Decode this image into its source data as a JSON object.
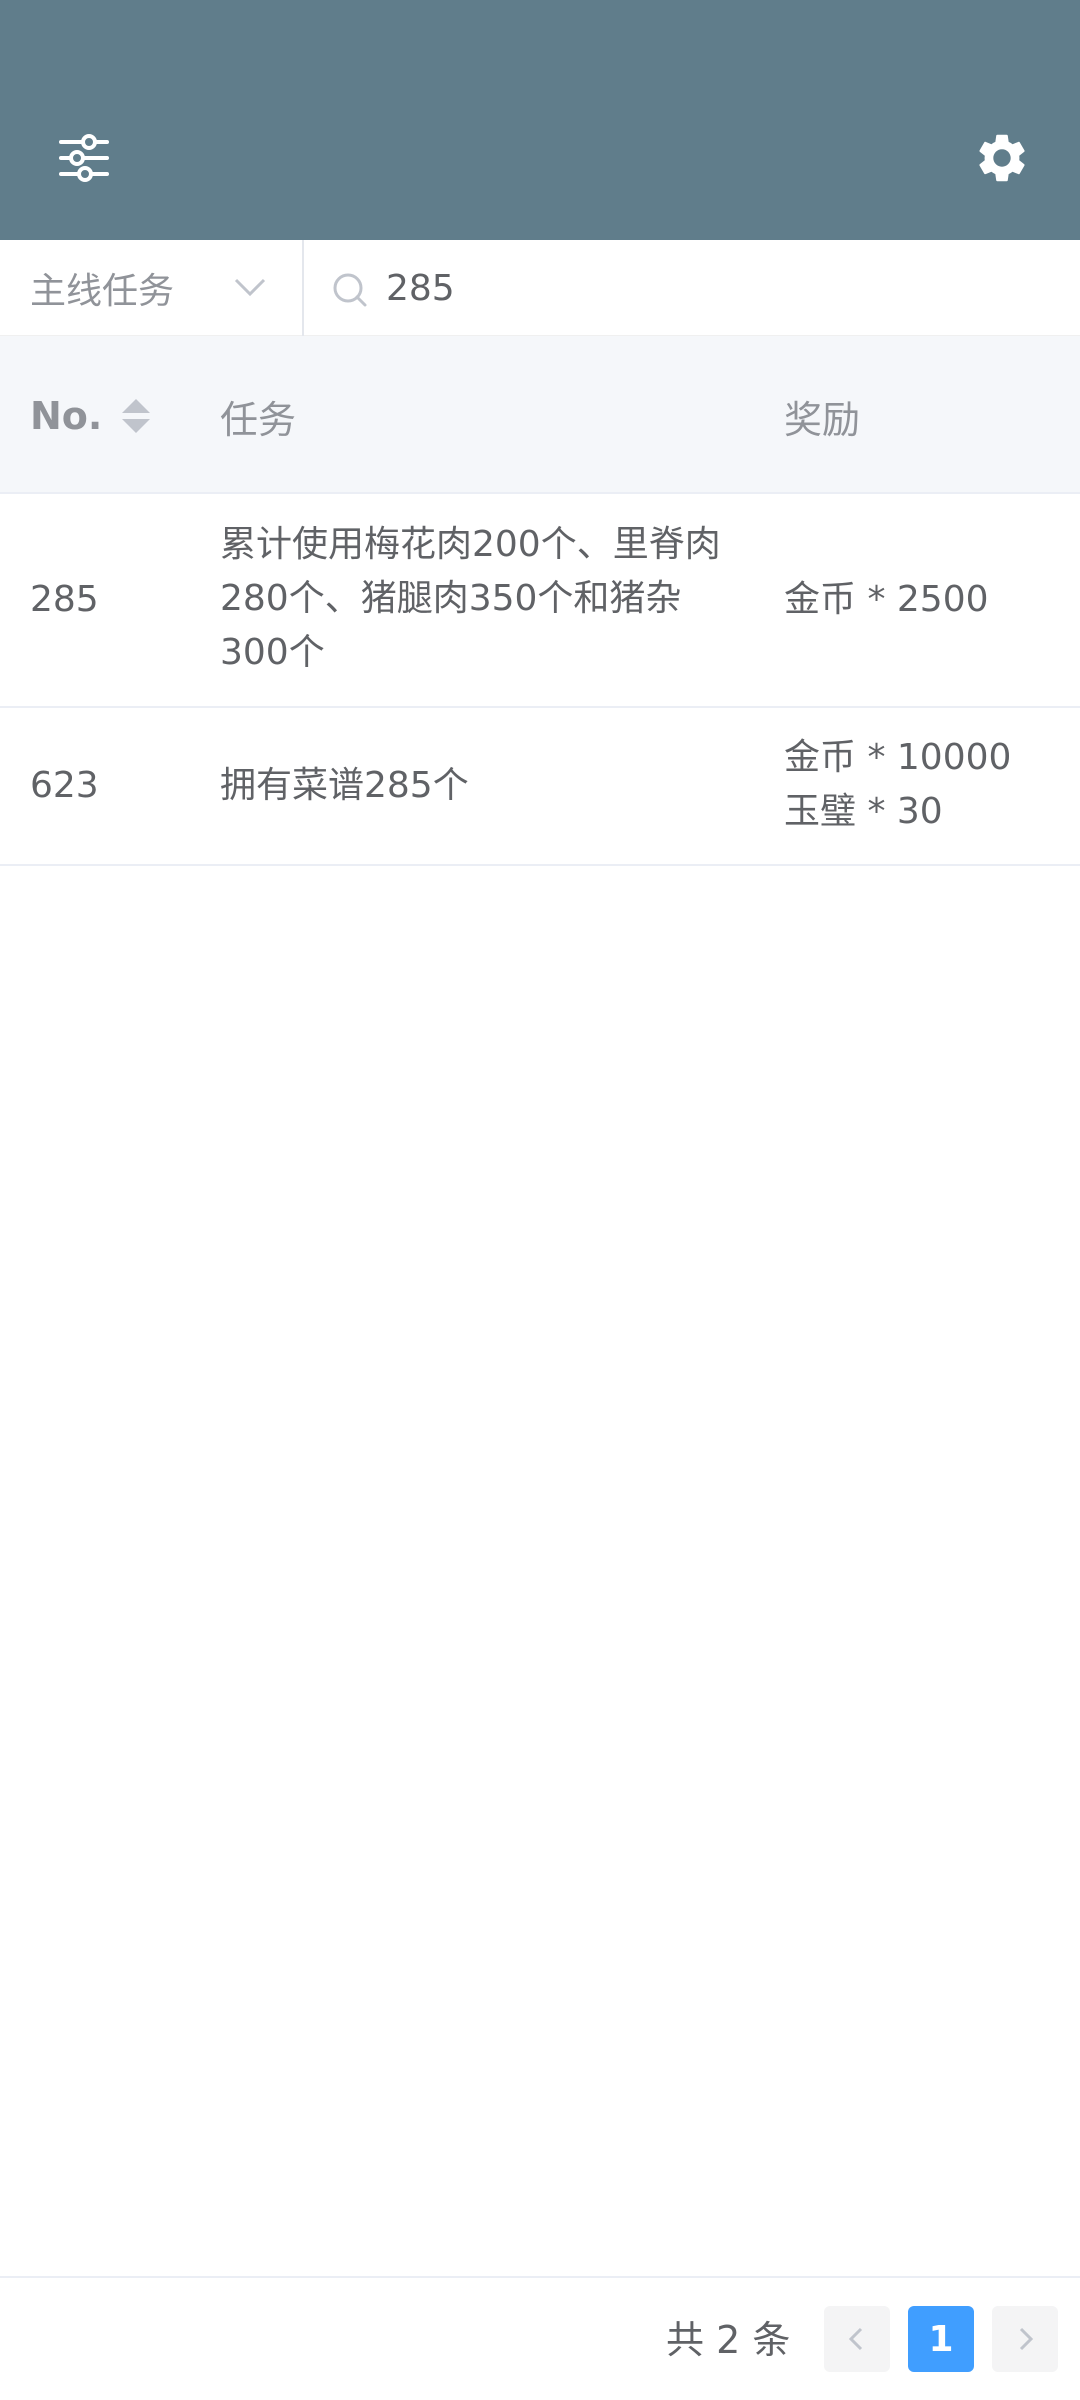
{
  "header": {
    "filter_icon": "sliders-icon",
    "settings_icon": "gear-icon",
    "color": "#607d8b"
  },
  "filter": {
    "category_selected": "主线任务",
    "search_value": "285"
  },
  "table": {
    "headers": {
      "no": "No.",
      "task": "任务",
      "reward": "奖励"
    },
    "rows": [
      {
        "no": "285",
        "task": "累计使用梅花肉200个、里脊肉280个、猪腿肉350个和猪杂300个",
        "rewards": [
          "金币 * 2500"
        ]
      },
      {
        "no": "623",
        "task": "拥有菜谱285个",
        "rewards": [
          "金币 * 10000",
          "玉璧 * 30"
        ]
      }
    ]
  },
  "pagination": {
    "total_text": "共 2 条",
    "current_page": "1",
    "accent": "#409eff"
  }
}
